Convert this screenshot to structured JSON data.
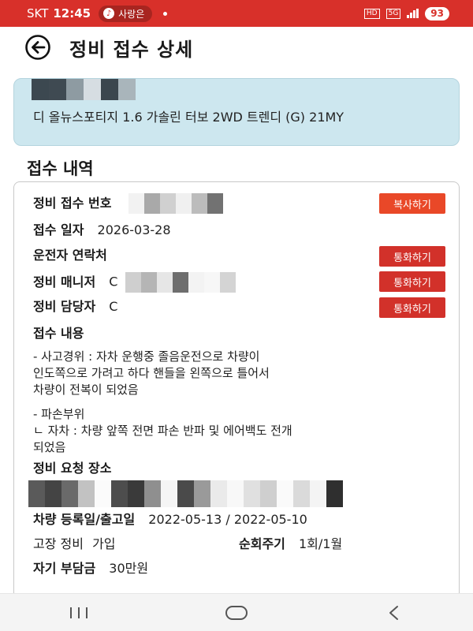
{
  "status_bar": {
    "carrier": "SKT",
    "time": "12:45",
    "notification_label": "사랑은",
    "battery": "93"
  },
  "header": {
    "title": "정비 접수 상세"
  },
  "vehicle": {
    "name": "디 올뉴스포티지 1.6 가솔린 터보 2WD 트렌디 (G) 21MY"
  },
  "section": {
    "title": "접수 내역"
  },
  "details": {
    "receipt_no_label": "정비 접수 번호",
    "copy_button": "복사하기",
    "receipt_date_label": "접수 일자",
    "receipt_date": "2026-03-28",
    "driver_contact_label": "운전자 연락처",
    "call_button": "통화하기",
    "manager_label": "정비 매니저",
    "manager_value": "C",
    "staff_label": "정비 담당자",
    "staff_value": "C",
    "content_label": "접수 내용",
    "content_accident_1": "- 사고경위 : 자차 운행중 졸음운전으로 차량이",
    "content_accident_2": "인도쪽으로 가려고 하다 핸들을 왼쪽으로 틀어서",
    "content_accident_3": "차량이 전복이 되었음",
    "content_damage_1": "- 파손부위",
    "content_damage_2": "ㄴ 자차 : 차량 앞쪽 전면 파손 반파 및 에어백도 전개",
    "content_damage_3": "되었음",
    "request_place_label": "정비 요청 장소",
    "reg_date_label": "차량 등록일/출고일",
    "reg_date_value": "2022-05-13 / 2022-05-10",
    "repair_label": "고장 정비",
    "repair_value": "가입",
    "cycle_label": "순회주기",
    "cycle_value": "1회/1월",
    "deductible_label": "자기 부담금",
    "deductible_value": "30만원"
  },
  "colors": {
    "status_bar": "#d8302a",
    "vehicle_card": "#cde7ef",
    "copy_button": "#e94828",
    "call_button": "#d2312a"
  },
  "icons": {
    "back": "arrow-left-circle-icon",
    "nav_recent": "recent-apps-icon",
    "nav_home": "home-icon",
    "nav_back": "back-chevron-icon"
  }
}
